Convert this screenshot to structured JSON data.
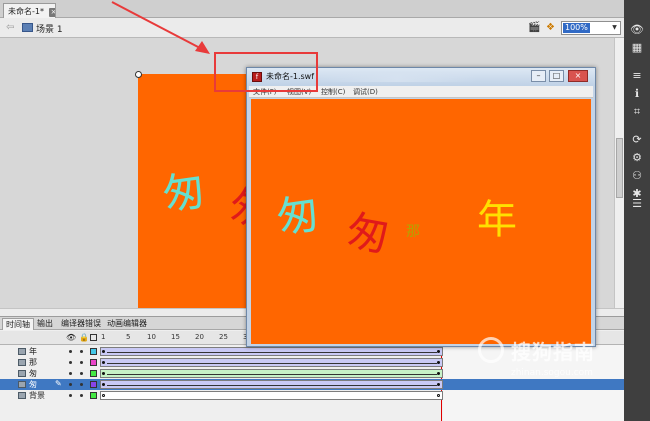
{
  "doc_tab": {
    "title": "未命名-1*",
    "close_glyph": "×"
  },
  "editbar": {
    "back_glyph": "⇦",
    "scene_label": "场景 1",
    "zoom_value": "100%",
    "zoom_arrow": "▼"
  },
  "stage_chars": [
    {
      "text": "匆",
      "color": "#66e0d0"
    },
    {
      "text": "匆",
      "color": "#e01a1a"
    }
  ],
  "swf_window": {
    "app_icon_glyph": "f",
    "title": "未命名-1.swf",
    "min_glyph": "–",
    "max_glyph": "□",
    "close_glyph": "×",
    "menu": [
      "文件(F)",
      "视图(V)",
      "控制(C)",
      "调试(D)"
    ],
    "chars": [
      {
        "text": "匆",
        "color": "#66e0d0"
      },
      {
        "text": "匆",
        "color": "#e01a1a"
      },
      {
        "text": "那",
        "color": "#b8a000"
      },
      {
        "text": "年",
        "color": "#ffe000"
      }
    ]
  },
  "timeline": {
    "tabs": [
      "时间轴",
      "输出",
      "编译器错误",
      "动画编辑器"
    ],
    "header": {
      "eye_glyph": "👁",
      "lock_glyph": "🔒"
    },
    "frame_numbers": [
      "1",
      "5",
      "10",
      "15",
      "20",
      "25",
      "3"
    ],
    "layers": [
      {
        "name": "年",
        "swatch": "#44c8e8",
        "selected": false
      },
      {
        "name": "那",
        "swatch": "#e844c8",
        "selected": false
      },
      {
        "name": "匆",
        "swatch": "#44e844",
        "selected": false
      },
      {
        "name": "匆",
        "swatch": "#8844e8",
        "selected": true
      },
      {
        "name": "背景",
        "swatch": "#44e844",
        "selected": false
      }
    ],
    "pencil_glyph": "✎"
  },
  "tools": [
    "👁",
    "▦",
    "≡",
    "ℹ",
    "⌗",
    "⟳",
    "⚙",
    "⚇",
    "✱",
    "☰"
  ],
  "watermark": {
    "text": "搜狗指南",
    "url": "zhinan.sogou.com"
  },
  "colors": {
    "stage": "#ff6600",
    "annotation": "#e83a3a",
    "selection": "#3f78c2"
  }
}
